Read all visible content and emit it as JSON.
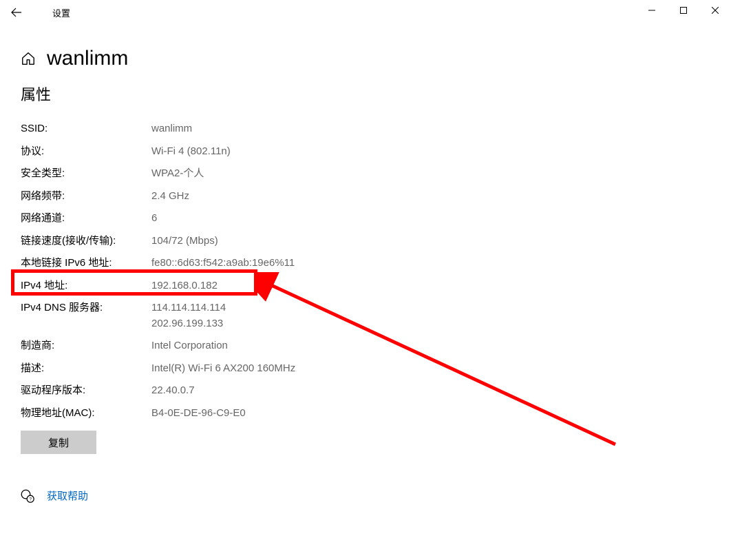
{
  "window": {
    "title": "设置"
  },
  "header": {
    "page_title": "wanlimm"
  },
  "section": {
    "properties_title": "属性"
  },
  "props": {
    "ssid_label": "SSID:",
    "ssid_value": "wanlimm",
    "protocol_label": "协议:",
    "protocol_value": "Wi-Fi 4 (802.11n)",
    "security_label": "安全类型:",
    "security_value": "WPA2-个人",
    "band_label": "网络频带:",
    "band_value": "2.4 GHz",
    "channel_label": "网络通道:",
    "channel_value": "6",
    "link_speed_label": "链接速度(接收/传输):",
    "link_speed_value": "104/72 (Mbps)",
    "local_ipv6_label": "本地链接 IPv6 地址:",
    "local_ipv6_value": "fe80::6d63:f542:a9ab:19e6%11",
    "ipv4_label": "IPv4 地址:",
    "ipv4_value": "192.168.0.182",
    "ipv4_dns_label": "IPv4 DNS 服务器:",
    "ipv4_dns_value1": "114.114.114.114",
    "ipv4_dns_value2": "202.96.199.133",
    "manufacturer_label": "制造商:",
    "manufacturer_value": "Intel Corporation",
    "description_label": "描述:",
    "description_value": "Intel(R) Wi-Fi 6 AX200 160MHz",
    "driver_ver_label": "驱动程序版本:",
    "driver_ver_value": "22.40.0.7",
    "mac_label": "物理地址(MAC):",
    "mac_value": "B4-0E-DE-96-C9-E0"
  },
  "buttons": {
    "copy": "复制"
  },
  "help": {
    "link": "获取帮助"
  }
}
